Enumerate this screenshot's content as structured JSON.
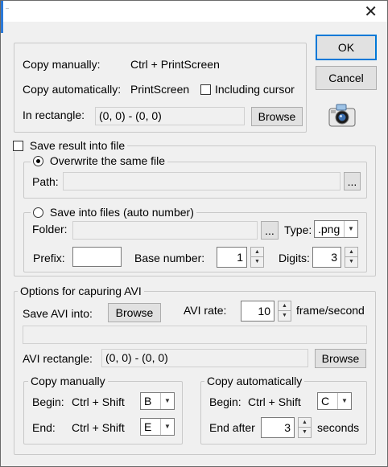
{
  "window": {
    "close_glyph": "✕"
  },
  "buttons": {
    "ok": "OK",
    "cancel": "Cancel"
  },
  "copy_group": {
    "manual_label": "Copy manually:",
    "manual_keys": "Ctrl + PrintScreen",
    "auto_label": "Copy automatically:",
    "auto_keys": "PrintScreen",
    "include_cursor_label": "Including cursor",
    "include_cursor_checked": false,
    "rect_label": "In rectangle:",
    "rect_value": "(0, 0) - (0, 0)",
    "browse_label": "Browse"
  },
  "save_group": {
    "legend": "Save result into file",
    "checked": false,
    "overwrite": {
      "legend": "Overwrite the same file",
      "selected": true,
      "path_label": "Path:",
      "path_value": "",
      "browse_dots": "..."
    },
    "autonumber": {
      "legend": "Save into files (auto number)",
      "selected": false,
      "folder_label": "Folder:",
      "folder_value": "",
      "browse_dots": "...",
      "type_label": "Type:",
      "type_value": ".png",
      "prefix_label": "Prefix:",
      "prefix_value": "",
      "base_label": "Base number:",
      "base_value": "1",
      "digits_label": "Digits:",
      "digits_value": "3"
    }
  },
  "avi_group": {
    "legend": "Options for capuring AVI",
    "save_into_label": "Save AVI into:",
    "browse_label": "Browse",
    "rate_label": "AVI rate:",
    "rate_value": "10",
    "rate_unit": "frame/second",
    "path_value": "",
    "rect_label": "AVI rectangle:",
    "rect_value": "(0, 0) - (0, 0)",
    "rect_browse_label": "Browse",
    "manual": {
      "legend": "Copy manually",
      "begin_label": "Begin:",
      "begin_keys": "Ctrl + Shift",
      "begin_key": "B",
      "end_label": "End:",
      "end_keys": "Ctrl + Shift",
      "end_key": "E"
    },
    "auto": {
      "legend": "Copy automatically",
      "begin_label": "Begin:",
      "begin_keys": "Ctrl + Shift",
      "begin_key": "C",
      "end_after_label": "End after",
      "end_after_value": "3",
      "seconds_label": "seconds"
    }
  },
  "icons": {
    "camera": "camera-icon",
    "dropdown": "▼",
    "spin_up": "▲",
    "spin_down": "▼"
  }
}
